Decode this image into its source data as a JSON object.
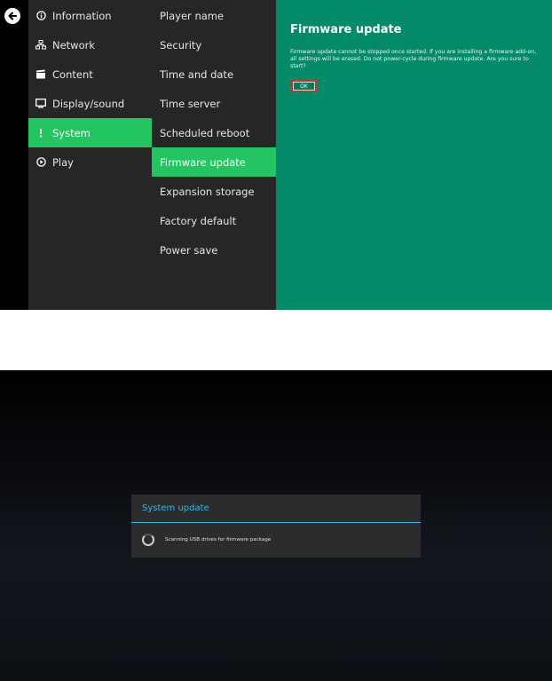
{
  "settings": {
    "main_menu": [
      {
        "label": "Information",
        "icon": "info-icon",
        "active": false
      },
      {
        "label": "Network",
        "icon": "network-icon",
        "active": false
      },
      {
        "label": "Content",
        "icon": "clapperboard-icon",
        "active": false
      },
      {
        "label": "Display/sound",
        "icon": "monitor-icon",
        "active": false
      },
      {
        "label": "System",
        "icon": "alert-icon",
        "active": true
      },
      {
        "label": "Play",
        "icon": "play-icon",
        "active": false
      }
    ],
    "sub_menu": [
      {
        "label": "Player name",
        "active": false
      },
      {
        "label": "Security",
        "active": false
      },
      {
        "label": "Time and date",
        "active": false
      },
      {
        "label": "Time server",
        "active": false
      },
      {
        "label": "Scheduled reboot",
        "active": false
      },
      {
        "label": "Firmware update",
        "active": true
      },
      {
        "label": "Expansion storage",
        "active": false
      },
      {
        "label": "Factory default",
        "active": false
      },
      {
        "label": "Power save",
        "active": false
      }
    ],
    "panel": {
      "title": "Firmware update",
      "message": "Firmware update cannot be stopped once started. If you are installing a firmware add-on, all settings will be erased. Do not power-cycle during firmware update. Are you sure to start?",
      "ok_label": "OK"
    },
    "colors": {
      "accent": "#22c55f",
      "panel": "#038a68",
      "menu_bg": "#262626"
    }
  },
  "system_update": {
    "title": "System update",
    "message": "Scanning USB drives for firmware package",
    "accent": "#33b5e5"
  }
}
